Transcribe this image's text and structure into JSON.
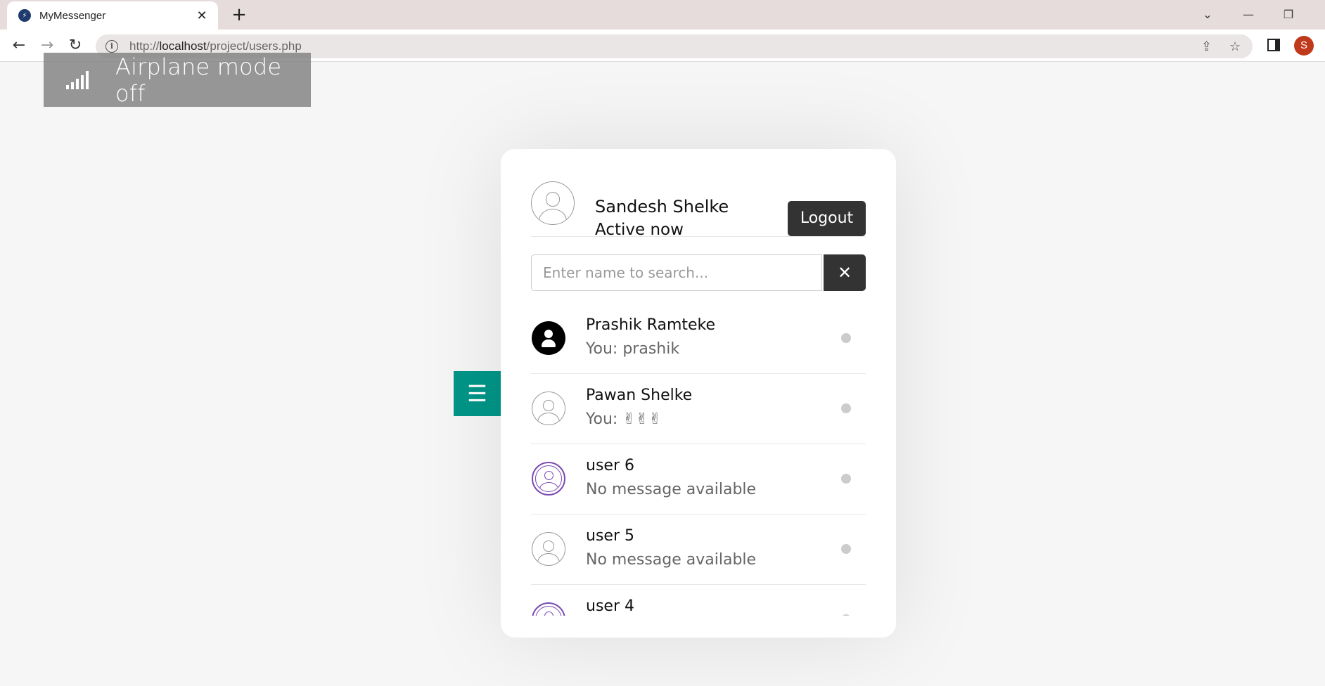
{
  "browser": {
    "tab_title": "MyMessenger",
    "url_prefix": "http://",
    "url_host": "localhost",
    "url_path": "/project/users.php",
    "profile_initial": "S"
  },
  "overlay": {
    "airplane_text": "Airplane mode off"
  },
  "header": {
    "user_name": "Sandesh Shelke",
    "user_status": "Active now",
    "logout_label": "Logout"
  },
  "search": {
    "placeholder": "Enter name to search..."
  },
  "users": [
    {
      "name": "Prashik Ramteke",
      "message": "You: prashik",
      "avatar": "solid",
      "status": "offline"
    },
    {
      "name": "Pawan Shelke",
      "message": "You: ✌✌✌",
      "avatar": "outline",
      "status": "offline"
    },
    {
      "name": "user 6",
      "message": "No message available",
      "avatar": "purple",
      "status": "offline"
    },
    {
      "name": "user 5",
      "message": "No message available",
      "avatar": "outline",
      "status": "offline"
    },
    {
      "name": "user 4",
      "message": "",
      "avatar": "purple",
      "status": "offline"
    }
  ],
  "colors": {
    "accent": "#009688",
    "dark_button": "#333333",
    "status_offline": "#cccccc",
    "avatar_purple": "#7b4bb3"
  }
}
